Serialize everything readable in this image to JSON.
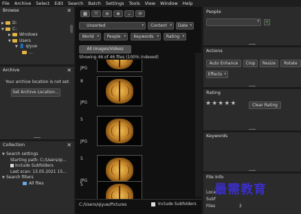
{
  "menu": [
    "File",
    "Archive",
    "Select",
    "Edit",
    "Search",
    "Batch",
    "Settings",
    "Tools",
    "View",
    "Window",
    "Help"
  ],
  "browse": {
    "title": "Browse",
    "tree": [
      {
        "label": "D:"
      },
      {
        "label": "C:"
      },
      {
        "label": "Windows"
      },
      {
        "label": "Users"
      },
      {
        "label": "qiyue"
      },
      {
        "label": "..."
      }
    ]
  },
  "archive": {
    "title": "Archive",
    "message": "Your archive location is not set.",
    "button": "Set Archive Location..."
  },
  "collection": {
    "title": "Collection",
    "items": [
      "Search settings",
      "Starting path: C:/Users/qi...",
      "Include Subfolders",
      "Last scan: 13.05.2021 15...",
      "Search filters",
      "All files"
    ]
  },
  "toolbar": {
    "unsorted": "Unsorted",
    "content": "Content",
    "date": "Date",
    "world": "World",
    "people": "People",
    "keywords": "Keywords",
    "rating": "Rating",
    "tab": "All Images/Videos",
    "status": "Showing 46 of 46 files (100% indexed)"
  },
  "thumbs": [
    {
      "n": "",
      "type": "JPG"
    },
    {
      "n": "8",
      "type": "JPG"
    },
    {
      "n": "5",
      "type": "JPG"
    },
    {
      "n": "5",
      "type": "JPG"
    },
    {
      "n": "5",
      "type": "JPG"
    }
  ],
  "statusbar": {
    "path": "C:/Users/qiyue/Pictures",
    "include": "Include Subfolders"
  },
  "right": {
    "people_title": "People",
    "actions_title": "Actions",
    "actions": [
      "Auto Enhance",
      "Crop",
      "Resize",
      "Rotate",
      "Effects"
    ],
    "rating_title": "Rating",
    "rating_stars": 5,
    "clear_rating": "Clear Rating",
    "keywords_title": "Keywords",
    "fileinfo_title": "File Info",
    "fileinfo_rows": [
      {
        "k": "Loca",
        "v": ""
      },
      {
        "k": "Subf",
        "v": ""
      },
      {
        "k": "Files",
        "v": "2"
      }
    ]
  },
  "watermark": "最需教育"
}
